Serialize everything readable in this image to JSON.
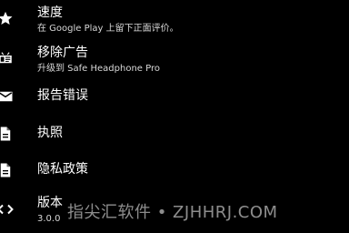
{
  "menu": {
    "items": [
      {
        "icon": "star-icon",
        "title": "速度",
        "subtitle": "在 Google Play 上留下正面评价。"
      },
      {
        "icon": "ad-remove-icon",
        "title": "移除广告",
        "subtitle": "升级到 Safe Headphone Pro"
      },
      {
        "icon": "email-icon",
        "title": "报告错误"
      },
      {
        "icon": "document-icon",
        "title": "执照"
      },
      {
        "icon": "document-icon",
        "title": "隐私政策"
      },
      {
        "icon": "code-icon",
        "title": "版本",
        "subtitle": "3.0.0"
      }
    ]
  },
  "watermark": "指尖汇软件 • ZJHHRJ.COM",
  "colors": {
    "background": "#000000",
    "text": "#ffffff",
    "subtext": "#d8d8d8"
  }
}
